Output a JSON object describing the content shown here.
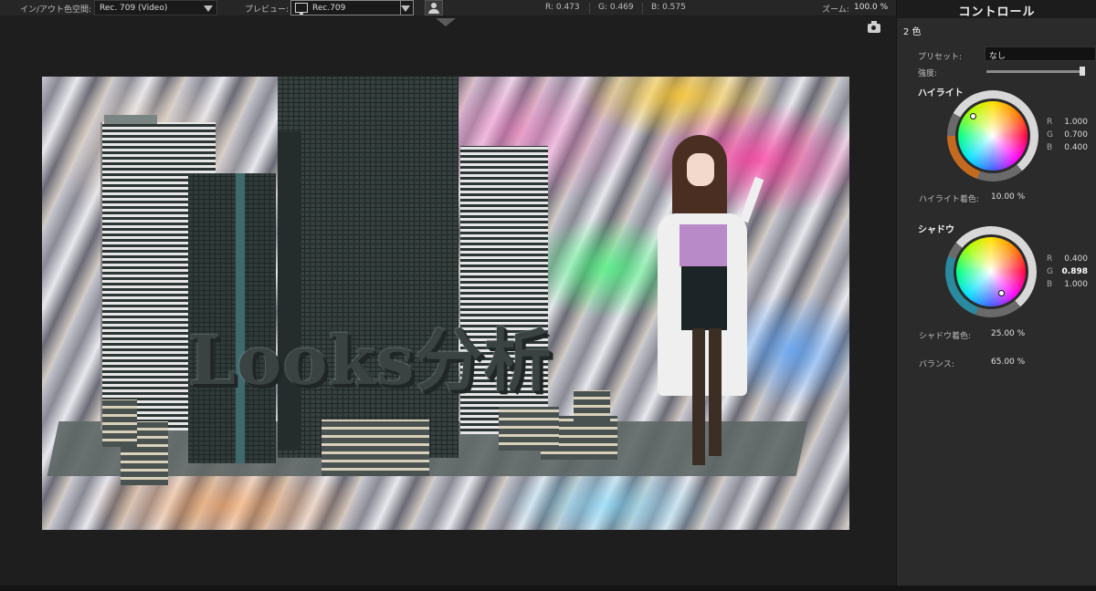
{
  "toolbar": {
    "inout_label": "イン/アウト色空間:",
    "inout_value": "Rec. 709 (Video)",
    "preview_label": "プレビュー:",
    "preview_value": "Rec.709",
    "r_readout": "R: 0.473",
    "g_readout": "G: 0.469",
    "b_readout": "B: 0.575",
    "zoom_label": "ズーム:",
    "zoom_value": "100.0 %",
    "icons": [
      "monitor-icon",
      "person-icon",
      "camera-icon"
    ]
  },
  "viewer": {
    "title_text": "Looks分析"
  },
  "panel": {
    "title": "コントロール",
    "mode": "2 色",
    "preset_label": "プリセット:",
    "preset_value": "なし",
    "strength_label": "強度:",
    "strength_value": 0.97,
    "highlight": {
      "heading": "ハイライト",
      "r_label": "R",
      "g_label": "G",
      "b_label": "B",
      "r": "1.000",
      "g": "0.700",
      "b": "0.400",
      "tint_label": "ハイライト着色:",
      "tint_value": "10.00 %",
      "marker_color": "#ffb366"
    },
    "shadow": {
      "heading": "シャドウ",
      "r_label": "R",
      "g_label": "G",
      "b_label": "B",
      "r": "0.400",
      "g": "0.898",
      "b": "1.000",
      "tint_label": "シャドウ着色:",
      "tint_value": "25.00 %",
      "marker_color": "#66e5ff"
    },
    "balance_label": "バランス:",
    "balance_value": "65.00 %"
  }
}
